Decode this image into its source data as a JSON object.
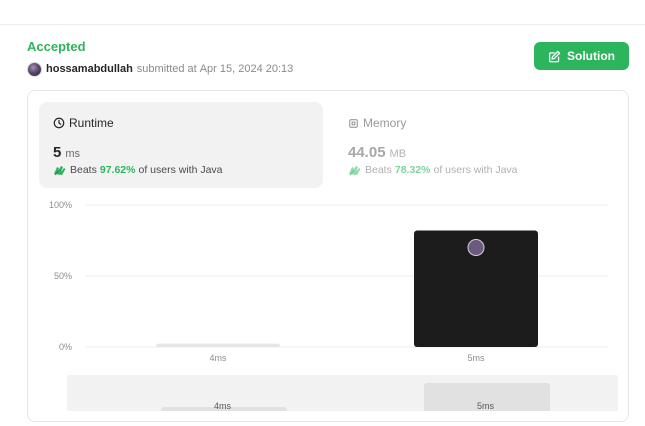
{
  "submission": {
    "status": "Accepted",
    "username": "hossamabdullah",
    "submitted_text": "submitted at",
    "submitted_time": "Apr 15, 2024 20:13",
    "solution_button": "Solution"
  },
  "runtime": {
    "title": "Runtime",
    "value": "5",
    "unit": "ms",
    "beats_prefix": "Beats",
    "beats_pct": "97.62%",
    "beats_suffix": "of users with Java"
  },
  "memory": {
    "title": "Memory",
    "value": "44.05",
    "unit": "MB",
    "beats_prefix": "Beats",
    "beats_pct": "78.32%",
    "beats_suffix": "of users with Java"
  },
  "colors": {
    "accent": "#2db55d",
    "selected_bar": "#1c1c1c",
    "bar": "#e6e6e6"
  },
  "chart_data": {
    "type": "bar",
    "categories": [
      "4ms",
      "5ms"
    ],
    "values": [
      2.4,
      82
    ],
    "highlight": "5ms",
    "ylim": [
      0,
      100
    ],
    "yticks": [
      "0%",
      "50%",
      "100%"
    ],
    "grid": true
  },
  "overview": {
    "labels": [
      "4ms",
      "5ms"
    ],
    "values": [
      4,
      32
    ]
  }
}
